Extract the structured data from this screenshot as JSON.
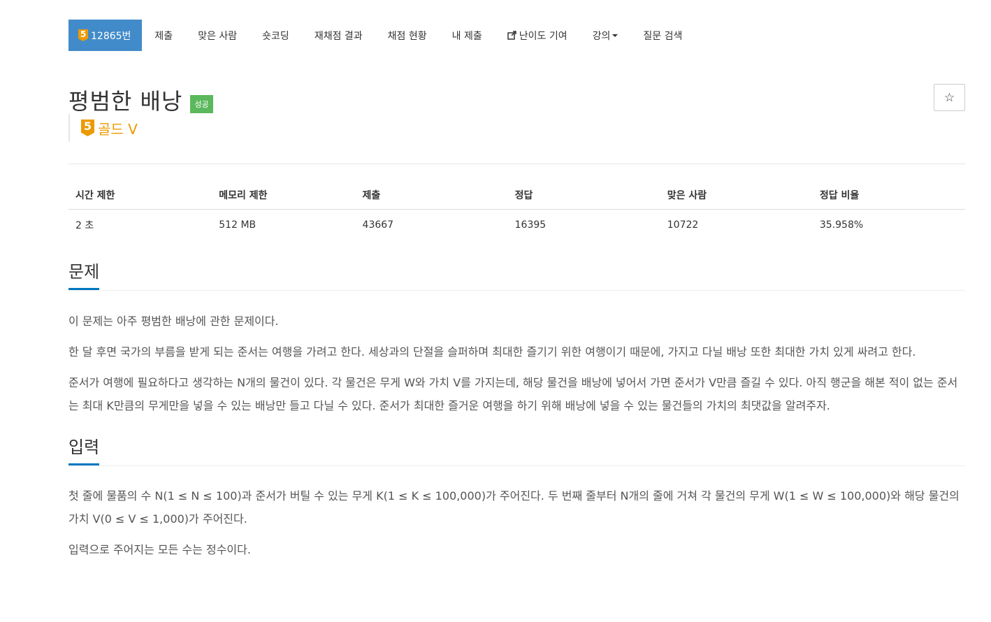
{
  "nav": {
    "problem_number": "12865번",
    "tier_level": "5",
    "items": [
      "제출",
      "맞은 사람",
      "숏코딩",
      "재채점 결과",
      "채점 현황",
      "내 제출",
      "난이도 기여",
      "강의",
      "질문 검색"
    ]
  },
  "problem": {
    "title": "평범한 배낭",
    "result_badge": "성공",
    "tier_level": "5",
    "tier_name": "골드 V",
    "star_icon": "☆"
  },
  "info_table": {
    "headers": [
      "시간 제한",
      "메모리 제한",
      "제출",
      "정답",
      "맞은 사람",
      "정답 비율"
    ],
    "values": [
      "2 초",
      "512 MB",
      "43667",
      "16395",
      "10722",
      "35.958%"
    ]
  },
  "sections": {
    "problem_title": "문제",
    "problem_paragraphs": [
      "이 문제는 아주 평범한 배낭에 관한 문제이다.",
      "한 달 후면 국가의 부름을 받게 되는 준서는 여행을 가려고 한다. 세상과의 단절을 슬퍼하며 최대한 즐기기 위한 여행이기 때문에, 가지고 다닐 배낭 또한 최대한 가치 있게 싸려고 한다.",
      "준서가 여행에 필요하다고 생각하는 N개의 물건이 있다. 각 물건은 무게 W와 가치 V를 가지는데, 해당 물건을 배낭에 넣어서 가면 준서가 V만큼 즐길 수 있다. 아직 행군을 해본 적이 없는 준서는 최대 K만큼의 무게만을 넣을 수 있는 배낭만 들고 다닐 수 있다. 준서가 최대한 즐거운 여행을 하기 위해 배낭에 넣을 수 있는 물건들의 가치의 최댓값을 알려주자."
    ],
    "input_title": "입력",
    "input_paragraphs": [
      "첫 줄에 물품의 수 N(1 ≤ N ≤ 100)과 준서가 버틸 수 있는 무게 K(1 ≤ K ≤ 100,000)가 주어진다. 두 번째 줄부터 N개의 줄에 거쳐 각 물건의 무게 W(1 ≤ W ≤ 100,000)와 해당 물건의 가치 V(0 ≤ V ≤ 1,000)가 주어진다.",
      "입력으로 주어지는 모든 수는 정수이다."
    ]
  }
}
